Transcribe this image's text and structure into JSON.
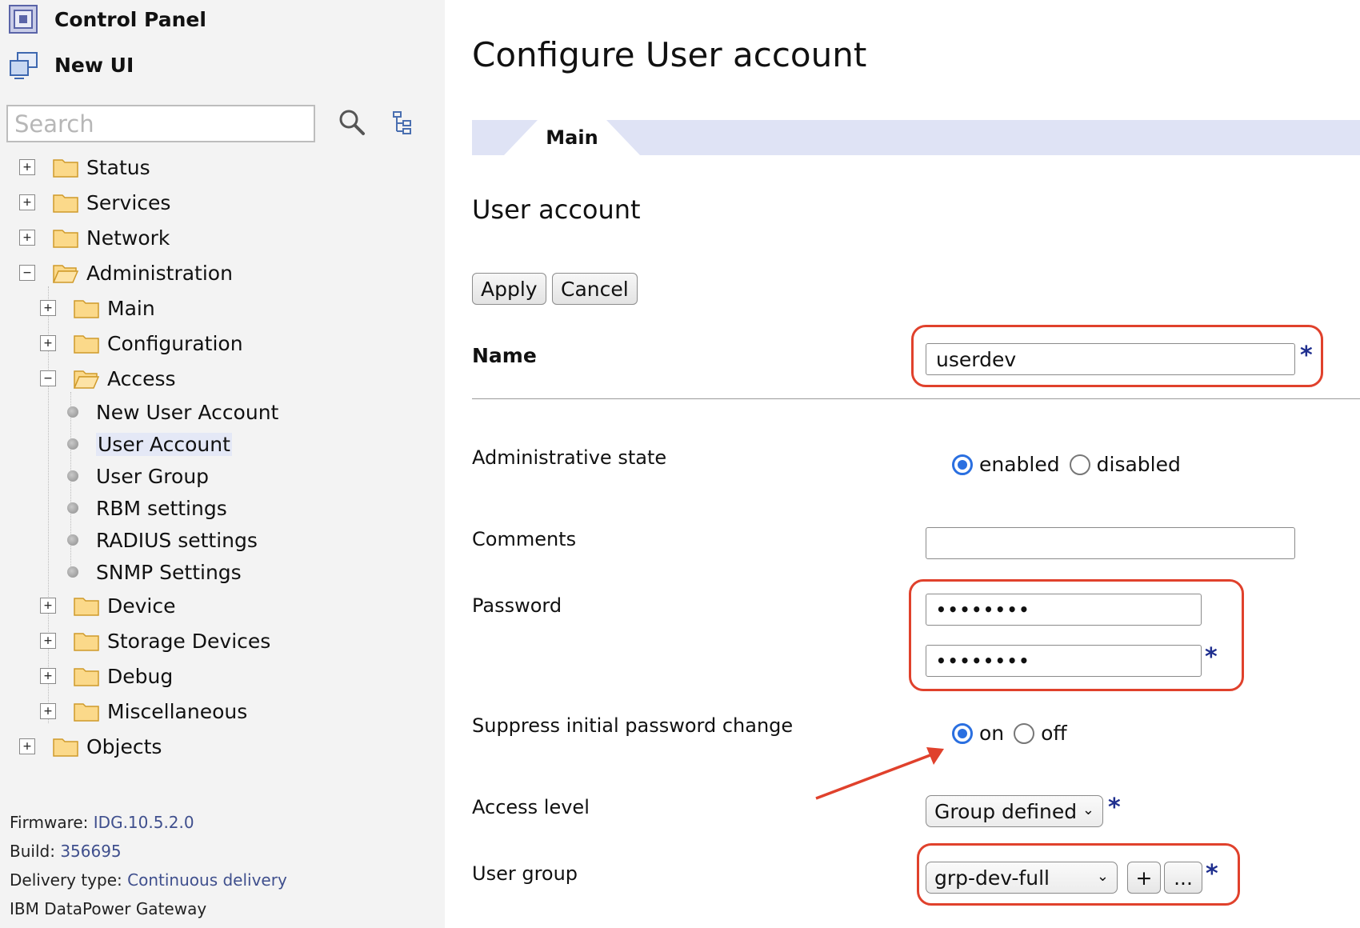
{
  "sidebar": {
    "header": {
      "control_panel": "Control Panel",
      "new_ui": "New UI"
    },
    "search": {
      "placeholder": "Search",
      "value": ""
    },
    "tree": {
      "status": "Status",
      "services": "Services",
      "network": "Network",
      "administration": "Administration",
      "main": "Main",
      "configuration": "Configuration",
      "access": "Access",
      "access_items": [
        "New User Account",
        "User Account",
        "User Group",
        "RBM settings",
        "RADIUS settings",
        "SNMP Settings"
      ],
      "device": "Device",
      "storage_devices": "Storage Devices",
      "debug": "Debug",
      "miscellaneous": "Miscellaneous",
      "objects": "Objects"
    },
    "footer": {
      "firmware_label": "Firmware:",
      "firmware_value": "IDG.10.5.2.0",
      "build_label": "Build:",
      "build_value": "356695",
      "delivery_label": "Delivery type:",
      "delivery_value": "Continuous delivery",
      "product": "IBM DataPower Gateway"
    }
  },
  "main": {
    "title": "Configure User account",
    "tabs": [
      {
        "label": "Main",
        "active": true
      }
    ],
    "section_title": "User account",
    "buttons": {
      "apply": "Apply",
      "cancel": "Cancel"
    },
    "form": {
      "name_label": "Name",
      "name_value": "userdev",
      "admin_state_label": "Administrative state",
      "admin_state_options": [
        "enabled",
        "disabled"
      ],
      "admin_state_selected": "enabled",
      "comments_label": "Comments",
      "comments_value": "",
      "password_label": "Password",
      "password_mask": "••••••••",
      "confirm_mask": "••••••••",
      "suppress_label": "Suppress initial password change",
      "suppress_options": [
        "on",
        "off"
      ],
      "suppress_selected": "on",
      "access_level_label": "Access level",
      "access_level_value": "Group defined",
      "user_group_label": "User group",
      "user_group_value": "grp-dev-full",
      "add_label": "+",
      "browse_label": "...",
      "required_marker": "*"
    }
  },
  "colors": {
    "highlight": "#e0412c",
    "accent": "#2a6fe0",
    "required": "#1f2f8f",
    "tabbar": "#dfe3f5"
  }
}
